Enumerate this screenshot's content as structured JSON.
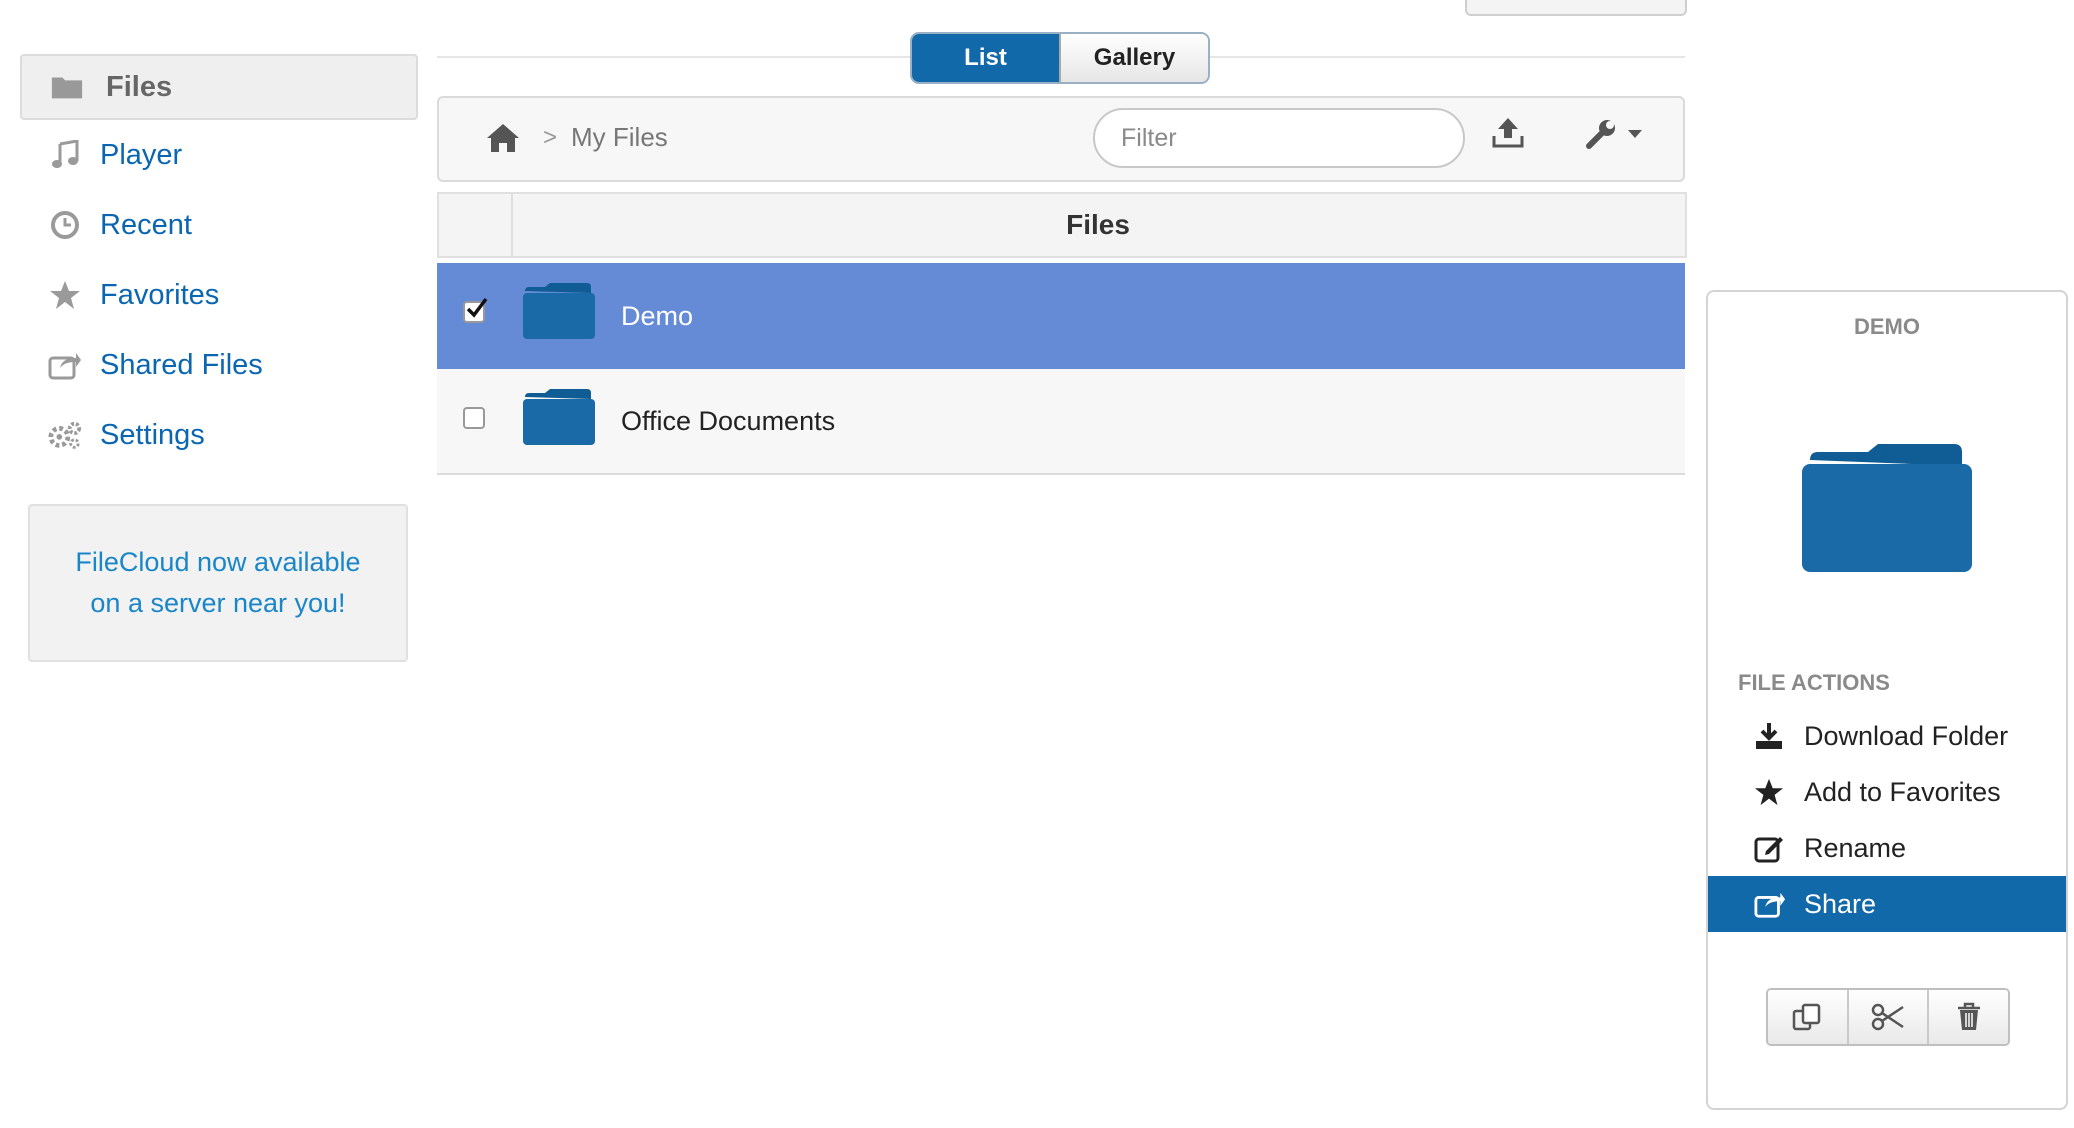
{
  "view_toggle": {
    "list": "List",
    "gallery": "Gallery",
    "active": "List"
  },
  "sidebar": {
    "items": [
      {
        "label": "Files",
        "icon": "folder-icon",
        "active": true
      },
      {
        "label": "Player",
        "icon": "music-icon"
      },
      {
        "label": "Recent",
        "icon": "clock-icon"
      },
      {
        "label": "Favorites",
        "icon": "star-icon"
      },
      {
        "label": "Shared Files",
        "icon": "share-icon"
      },
      {
        "label": "Settings",
        "icon": "gears-icon"
      }
    ],
    "promo": {
      "line1": "FileCloud now available",
      "line2": "on a server near you!"
    }
  },
  "toolbar": {
    "breadcrumb": {
      "separator": ">",
      "current": "My Files"
    },
    "filter_placeholder": "Filter"
  },
  "table": {
    "header": "Files",
    "rows": [
      {
        "name": "Demo",
        "checked": true,
        "selected": true
      },
      {
        "name": "Office Documents",
        "checked": false,
        "selected": false
      }
    ]
  },
  "details_panel": {
    "title": "DEMO",
    "actions_heading": "FILE ACTIONS",
    "actions": [
      {
        "label": "Download Folder",
        "icon": "download-icon"
      },
      {
        "label": "Add to Favorites",
        "icon": "star-icon"
      },
      {
        "label": "Rename",
        "icon": "edit-icon"
      },
      {
        "label": "Share",
        "icon": "share-icon",
        "highlighted": true
      }
    ],
    "buttons": [
      "copy-icon",
      "scissors-icon",
      "trash-icon"
    ]
  },
  "colors": {
    "accent": "#1169a9",
    "selected_row": "#658bd6",
    "link": "#0b66b2",
    "folder": "#1a6aa8"
  }
}
